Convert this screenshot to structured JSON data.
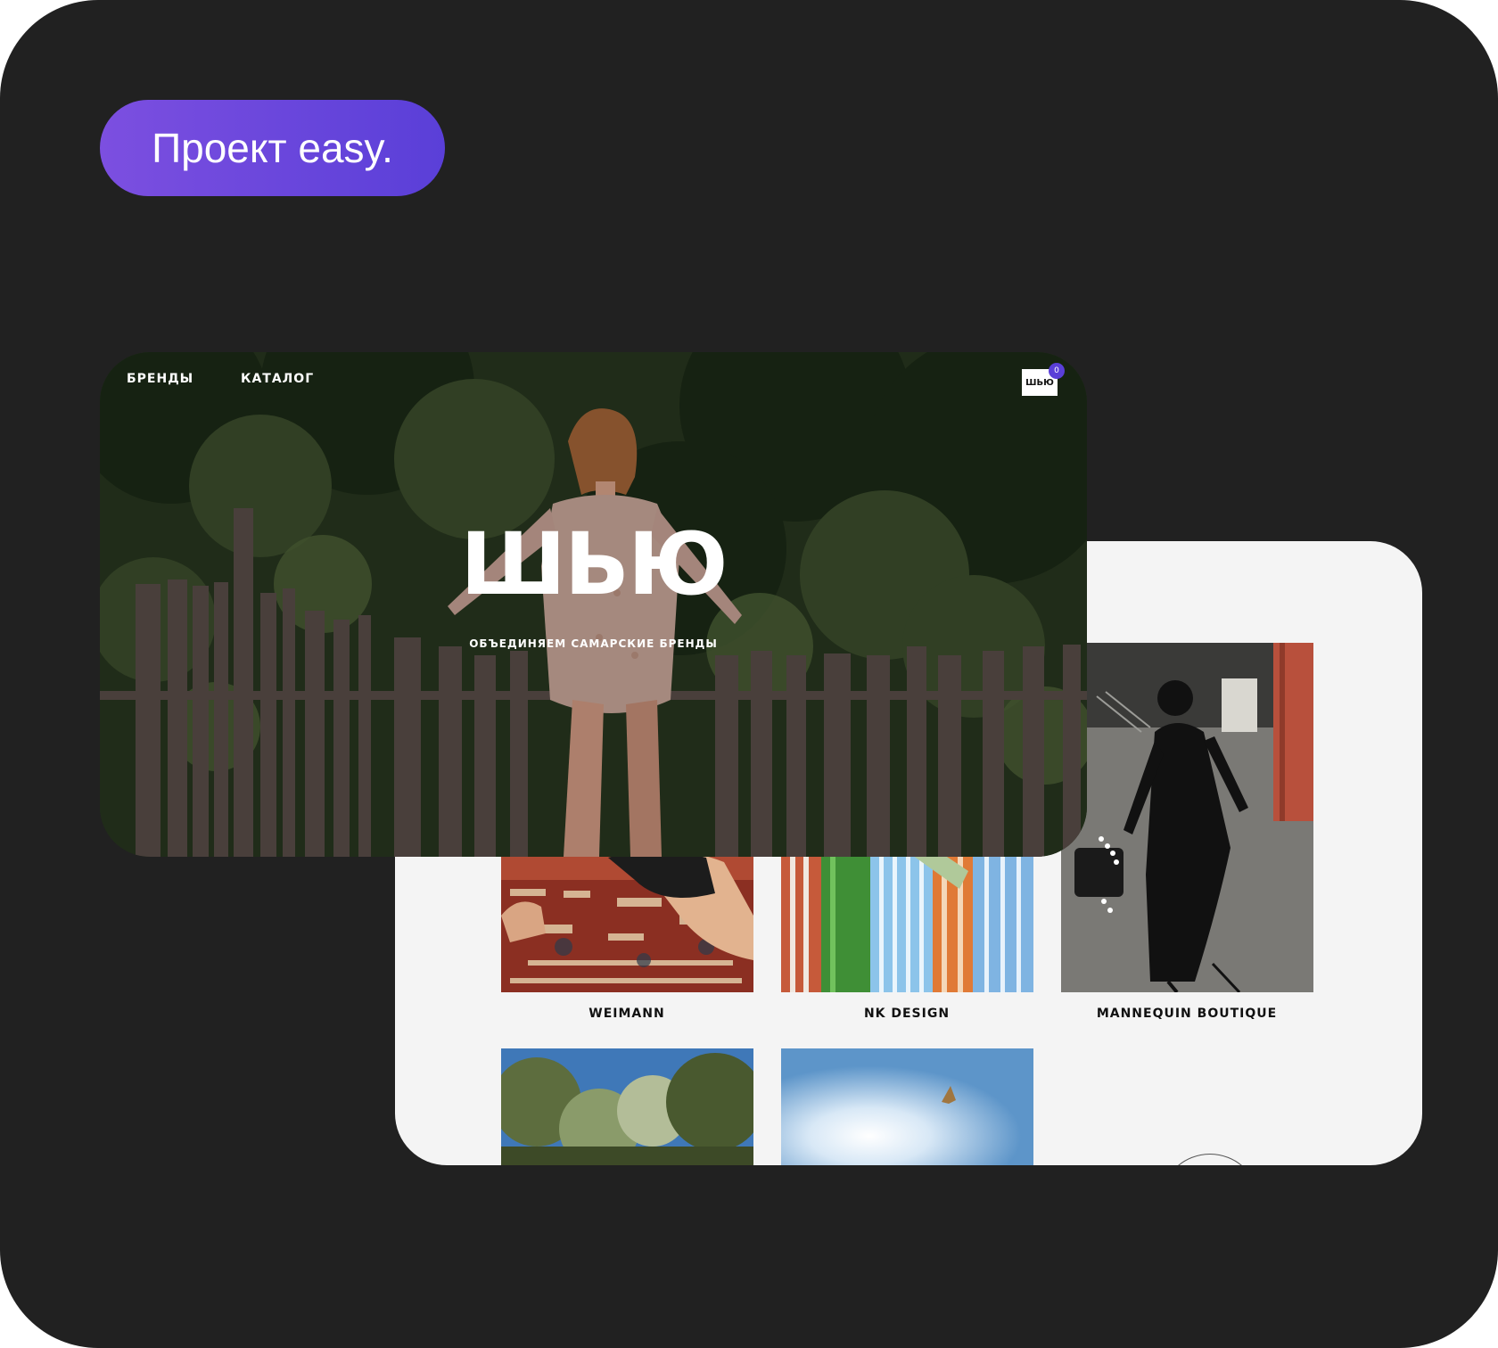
{
  "badge": {
    "label": "Проект easy."
  },
  "hero": {
    "nav": [
      {
        "label": "БРЕНДЫ"
      },
      {
        "label": "КАТАЛОГ"
      }
    ],
    "logo": "ШЬЮ",
    "cart_count": "0",
    "title": "ШЬЮ",
    "subtitle": "ОБЪЕДИНЯЕМ САМАРСКИЕ БРЕНДЫ"
  },
  "catalog": {
    "brands": [
      {
        "name": "WEIMANN"
      },
      {
        "name": "NK DESIGN"
      },
      {
        "name": "MANNEQUIN BOUTIQUE"
      }
    ]
  },
  "colors": {
    "background": "#212121",
    "accent": "#5a3fd8",
    "panel": "#f4f4f4"
  }
}
